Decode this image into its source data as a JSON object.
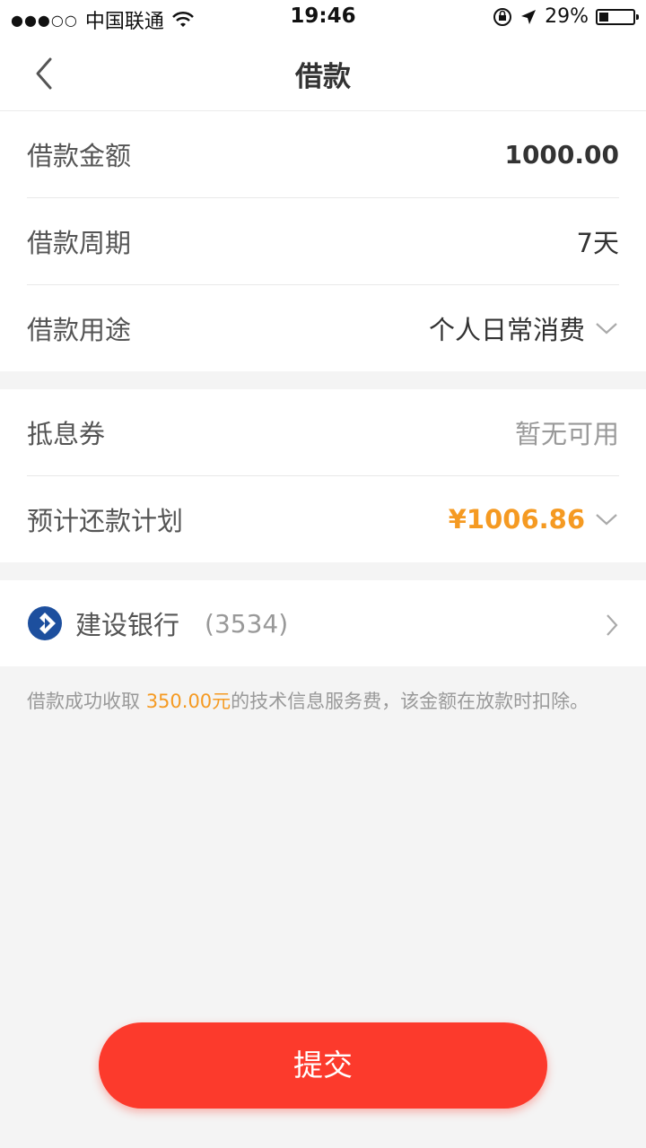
{
  "status_bar": {
    "signal": "●●●○○",
    "carrier": "中国联通",
    "time": "19:46",
    "battery": "29%",
    "battery_level": 0.29
  },
  "nav": {
    "title": "借款",
    "back_icon": "chevron-left-icon"
  },
  "loan_group": [
    {
      "label": "借款金额",
      "value": "1000.00"
    },
    {
      "label": "借款周期",
      "value": "7天"
    },
    {
      "label": "借款用途",
      "value": "个人日常消费"
    }
  ],
  "plan_group": [
    {
      "label": "抵息券",
      "value": "暂无可用"
    },
    {
      "label": "预计还款计划",
      "value": "¥1006.86"
    }
  ],
  "bank": {
    "name": "建设银行",
    "number": "(3534)",
    "logo_icon": "bank-logo-icon"
  },
  "notice": {
    "prefix": "借款成功收取 ",
    "highlight": "350.00元",
    "suffix": "的技术信息服务费，该金额在放款时扣除。"
  },
  "submit_label": "提交",
  "colors": {
    "accent": "#f59a22",
    "button": "#fc3a2c",
    "bank_blue": "#1d4f9e"
  }
}
